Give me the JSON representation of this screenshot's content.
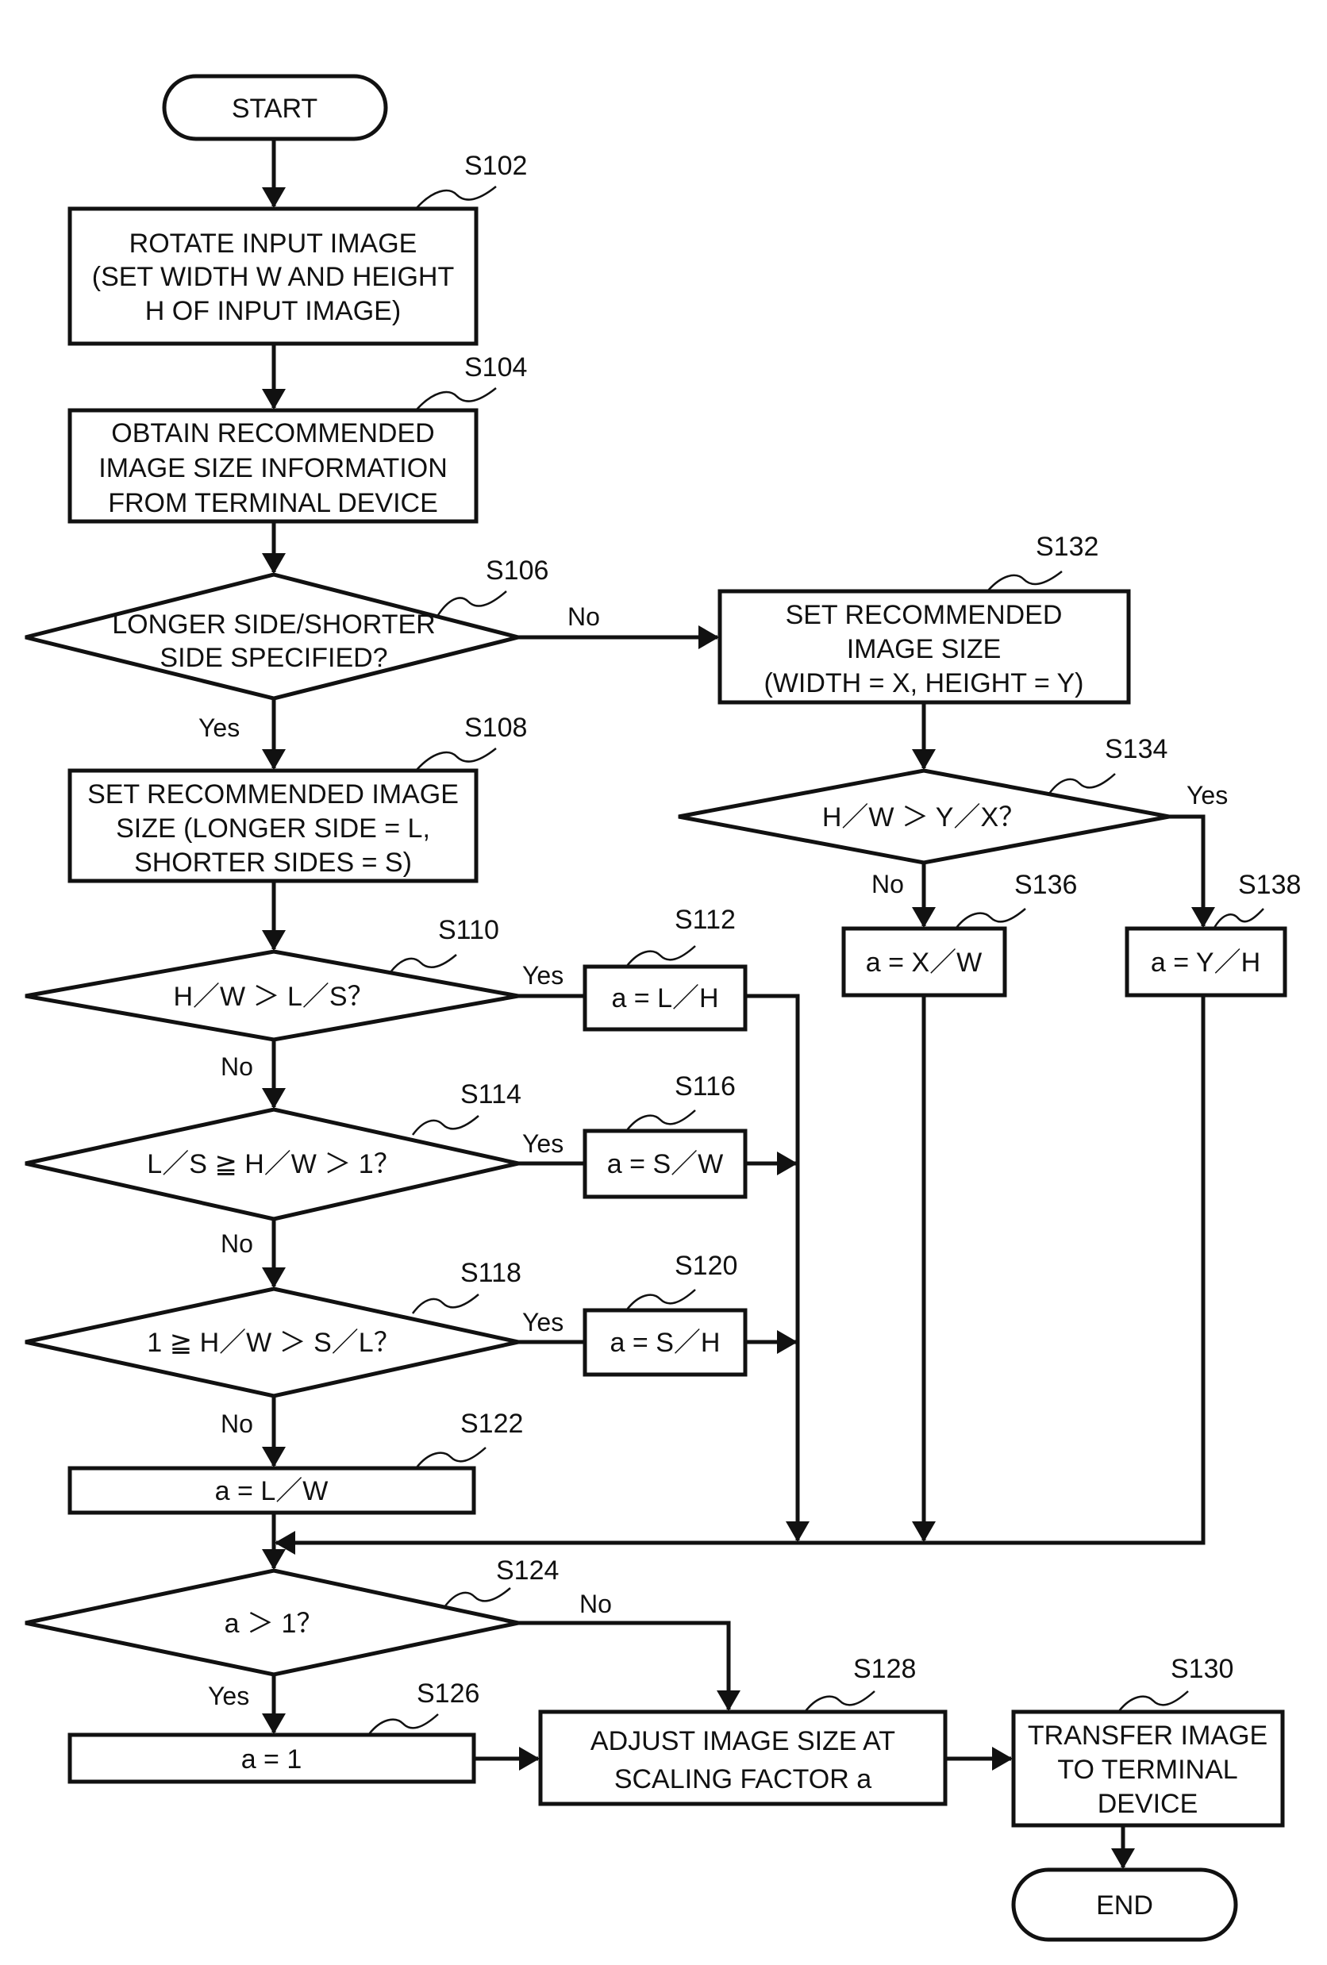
{
  "flowchart": {
    "nodes": {
      "start": {
        "label": "START"
      },
      "s102": {
        "step": "S102",
        "lines": [
          "ROTATE INPUT IMAGE",
          "(SET WIDTH W AND HEIGHT",
          "H OF INPUT IMAGE)"
        ]
      },
      "s104": {
        "step": "S104",
        "lines": [
          "OBTAIN RECOMMENDED",
          "IMAGE SIZE INFORMATION",
          "FROM TERMINAL DEVICE"
        ]
      },
      "s106": {
        "step": "S106",
        "lines": [
          "LONGER SIDE/SHORTER",
          "SIDE SPECIFIED?"
        ]
      },
      "s108": {
        "step": "S108",
        "lines": [
          "SET RECOMMENDED IMAGE",
          "SIZE (LONGER SIDE = L,",
          "SHORTER SIDES = S)"
        ]
      },
      "s110": {
        "step": "S110",
        "lines": [
          "H／W ＞ L／S？"
        ]
      },
      "s112": {
        "step": "S112",
        "lines": [
          "a = L／H"
        ]
      },
      "s114": {
        "step": "S114",
        "lines": [
          "L／S ≧ H／W ＞ 1？"
        ]
      },
      "s116": {
        "step": "S116",
        "lines": [
          "a = S／W"
        ]
      },
      "s118": {
        "step": "S118",
        "lines": [
          "1 ≧ H／W ＞ S／L？"
        ]
      },
      "s120": {
        "step": "S120",
        "lines": [
          "a = S／H"
        ]
      },
      "s122": {
        "step": "S122",
        "lines": [
          "a = L／W"
        ]
      },
      "s124": {
        "step": "S124",
        "lines": [
          "a ＞ 1？"
        ]
      },
      "s126": {
        "step": "S126",
        "lines": [
          "a = 1"
        ]
      },
      "s128": {
        "step": "S128",
        "lines": [
          "ADJUST IMAGE SIZE AT",
          "SCALING FACTOR a"
        ]
      },
      "s130": {
        "step": "S130",
        "lines": [
          "TRANSFER IMAGE",
          "TO TERMINAL",
          "DEVICE"
        ]
      },
      "s132": {
        "step": "S132",
        "lines": [
          "SET RECOMMENDED",
          "IMAGE SIZE",
          "(WIDTH = X, HEIGHT = Y)"
        ]
      },
      "s134": {
        "step": "S134",
        "lines": [
          "H／W ＞ Y／X？"
        ]
      },
      "s136": {
        "step": "S136",
        "lines": [
          "a = X／W"
        ]
      },
      "s138": {
        "step": "S138",
        "lines": [
          "a = Y／H"
        ]
      },
      "end": {
        "label": "END"
      }
    },
    "branches": {
      "s106_no": "No",
      "s106_yes": "Yes",
      "s110_yes": "Yes",
      "s110_no": "No",
      "s114_yes": "Yes",
      "s114_no": "No",
      "s118_yes": "Yes",
      "s118_no": "No",
      "s124_no": "No",
      "s124_yes": "Yes",
      "s134_yes": "Yes",
      "s134_no": "No"
    },
    "edges": [
      [
        "start",
        "s102"
      ],
      [
        "s102",
        "s104"
      ],
      [
        "s104",
        "s106"
      ],
      [
        "s106",
        "s108",
        "Yes"
      ],
      [
        "s106",
        "s132",
        "No"
      ],
      [
        "s108",
        "s110"
      ],
      [
        "s110",
        "s112",
        "Yes"
      ],
      [
        "s110",
        "s114",
        "No"
      ],
      [
        "s114",
        "s116",
        "Yes"
      ],
      [
        "s114",
        "s118",
        "No"
      ],
      [
        "s118",
        "s120",
        "Yes"
      ],
      [
        "s118",
        "s122",
        "No"
      ],
      [
        "s112",
        "s124"
      ],
      [
        "s116",
        "s124"
      ],
      [
        "s120",
        "s124"
      ],
      [
        "s122",
        "s124"
      ],
      [
        "s132",
        "s134"
      ],
      [
        "s134",
        "s138",
        "Yes"
      ],
      [
        "s134",
        "s136",
        "No"
      ],
      [
        "s136",
        "s124"
      ],
      [
        "s138",
        "s124"
      ],
      [
        "s124",
        "s126",
        "Yes"
      ],
      [
        "s124",
        "s128",
        "No"
      ],
      [
        "s126",
        "s128"
      ],
      [
        "s128",
        "s130"
      ],
      [
        "s130",
        "end"
      ]
    ]
  }
}
